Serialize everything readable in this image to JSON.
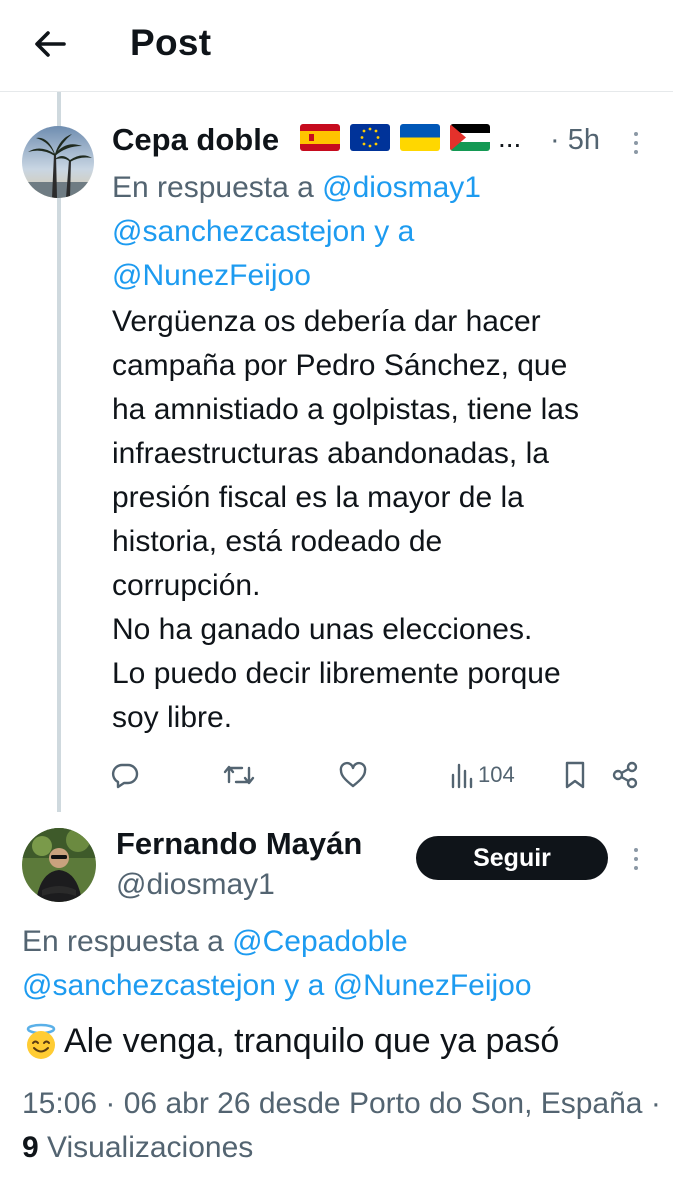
{
  "header": {
    "title": "Post"
  },
  "reply_tweet": {
    "author_name": "Cepa doble",
    "flags": [
      "spain-flag",
      "eu-flag",
      "ukraine-flag",
      "palestine-flag"
    ],
    "truncation": "...",
    "time": "· 5h",
    "replying_prefix": "En respuesta a",
    "mention_1": "@diosmay1",
    "mention_2": "@sanchezcastejon",
    "connector": "y a",
    "mention_3": "@NunezFeijoo",
    "text_lines": [
      "Vergüenza os debería dar hacer",
      "campaña por Pedro Sánchez, que",
      "ha amnistiado a golpistas, tiene las",
      "infraestructuras abandonadas, la",
      "presión fiscal es la mayor de la",
      "historia, está rodeado de",
      "corrupción.",
      "No ha ganado unas elecciones.",
      "Lo puedo decir libremente porque",
      "soy libre."
    ],
    "views": "104"
  },
  "main_tweet": {
    "author_name": "Fernando Mayán",
    "handle": "@diosmay1",
    "follow_label": "Seguir",
    "replying_prefix": "En respuesta a",
    "mention_1": "@Cepadoble",
    "mention_2": "@sanchezcastejon",
    "connector": "y a",
    "mention_3": "@NunezFeijoo",
    "emoji": "smiling-face-with-halo",
    "text": "Ale venga, tranquilo que ya pasó",
    "time": "15:06",
    "date": "06 abr 26",
    "source": "desde Porto do Son, España",
    "views_count": "9",
    "views_label": "Visualizaciones"
  },
  "colors": {
    "link": "#1d9bf0",
    "secondary": "#536471",
    "text": "#0f1419",
    "thread": "#cfd9de"
  }
}
